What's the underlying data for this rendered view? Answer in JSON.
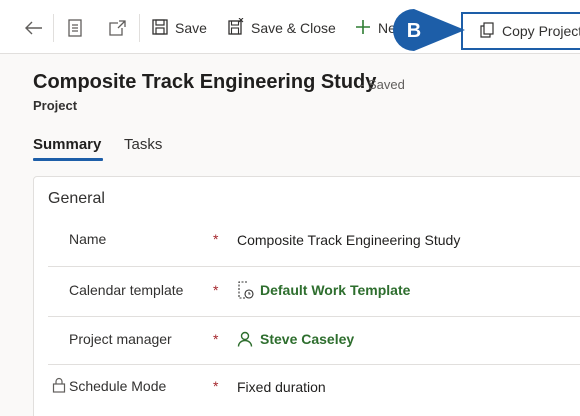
{
  "toolbar": {
    "save_label": "Save",
    "save_close_label": "Save & Close",
    "new_label": "Ne",
    "copy_project_label": "Copy Project"
  },
  "callout": {
    "letter": "B",
    "color": "#1d5ea8"
  },
  "header": {
    "title": "Composite Track Engineering Study",
    "status": "- Saved",
    "entity": "Project"
  },
  "tabs": [
    {
      "label": "Summary",
      "active": true
    },
    {
      "label": "Tasks",
      "active": false
    }
  ],
  "section": {
    "title": "General",
    "fields": [
      {
        "label": "Name",
        "required": "*",
        "value": "Composite Track Engineering Study"
      },
      {
        "label": "Calendar template",
        "required": "*",
        "value": "Default Work Template"
      },
      {
        "label": "Project manager",
        "required": "*",
        "value": "Steve Caseley"
      },
      {
        "label": "Schedule Mode",
        "required": "*",
        "value": "Fixed duration"
      }
    ]
  },
  "colors": {
    "accent": "#1d5ea8",
    "link": "#2e6e2e",
    "required": "#a4262c"
  }
}
